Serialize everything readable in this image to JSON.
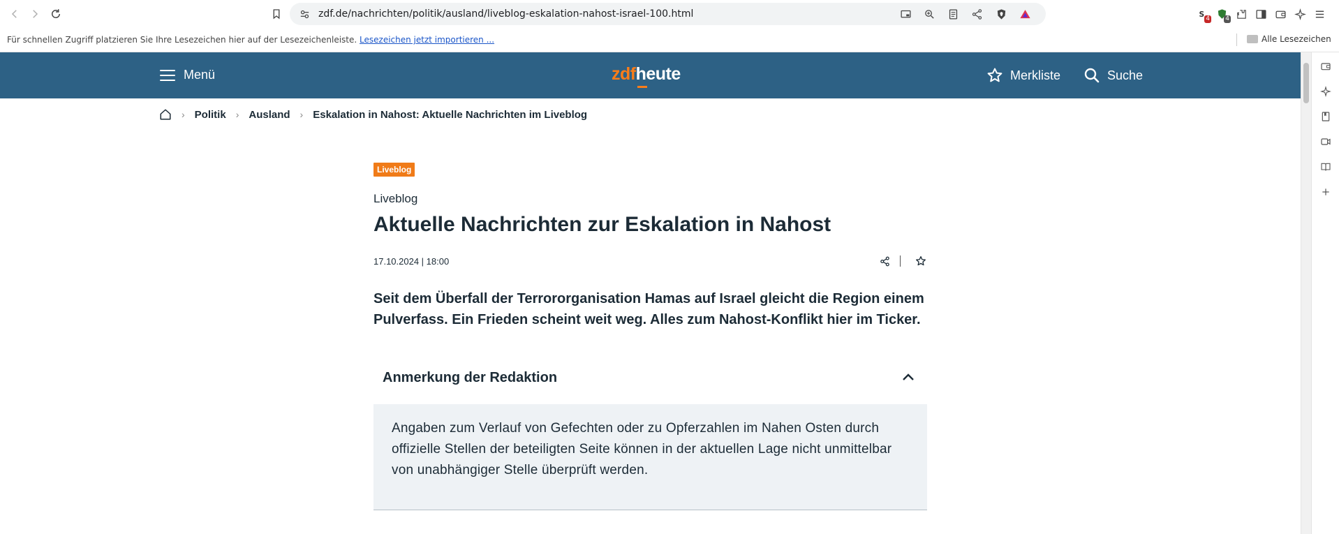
{
  "browser": {
    "url": "zdf.de/nachrichten/politik/ausland/liveblog-eskalation-nahost-israel-100.html",
    "extension_badges": [
      "4",
      "4"
    ]
  },
  "bookmarks_bar": {
    "hint": "Für schnellen Zugriff platzieren Sie Ihre Lesezeichen hier auf der Lesezeichenleiste.",
    "import_link": "Lesezeichen jetzt importieren ...",
    "all_bookmarks": "Alle Lesezeichen"
  },
  "header": {
    "menu_label": "Menü",
    "logo_zdf": "zdf",
    "logo_heute": "heute",
    "watchlist_label": "Merkliste",
    "search_label": "Suche",
    "brand_color": "#2d6185",
    "accent_color": "#fa7d19"
  },
  "breadcrumb": {
    "items": [
      "Politik",
      "Ausland",
      "Eskalation in Nahost: Aktuelle Nachrichten im Liveblog"
    ]
  },
  "article": {
    "tag": "Liveblog",
    "overline": "Liveblog",
    "headline": "Aktuelle Nachrichten zur Eskalation in Nahost",
    "date": "17.10.2024 | 18:00",
    "lead": "Seit dem Überfall der Terrororganisation Hamas auf Israel gleicht die Region einem Pulverfass. Ein Frieden scheint weit weg. Alles zum Nahost-Konflikt hier im Ticker."
  },
  "editor_note": {
    "title": "Anmerkung der Redaktion",
    "text": "Angaben zum Verlauf von Gefechten oder zu Opferzahlen im Nahen Osten durch offizielle Stellen der beteiligten Seite können in der aktuellen Lage nicht unmittelbar von unabhängiger Stelle überprüft werden."
  },
  "icons": [
    "back-icon",
    "forward-icon",
    "reload-icon",
    "bookmark-icon",
    "site-settings-icon",
    "cast-icon",
    "zoom-icon",
    "reader-icon",
    "share-icon",
    "brave-shield-icon",
    "rewards-icon",
    "extensions-icon",
    "sidebar-icon",
    "wallet-icon",
    "leo-icon",
    "app-menu-icon",
    "home-icon",
    "star-icon",
    "search-icon",
    "chevron-up-icon"
  ]
}
